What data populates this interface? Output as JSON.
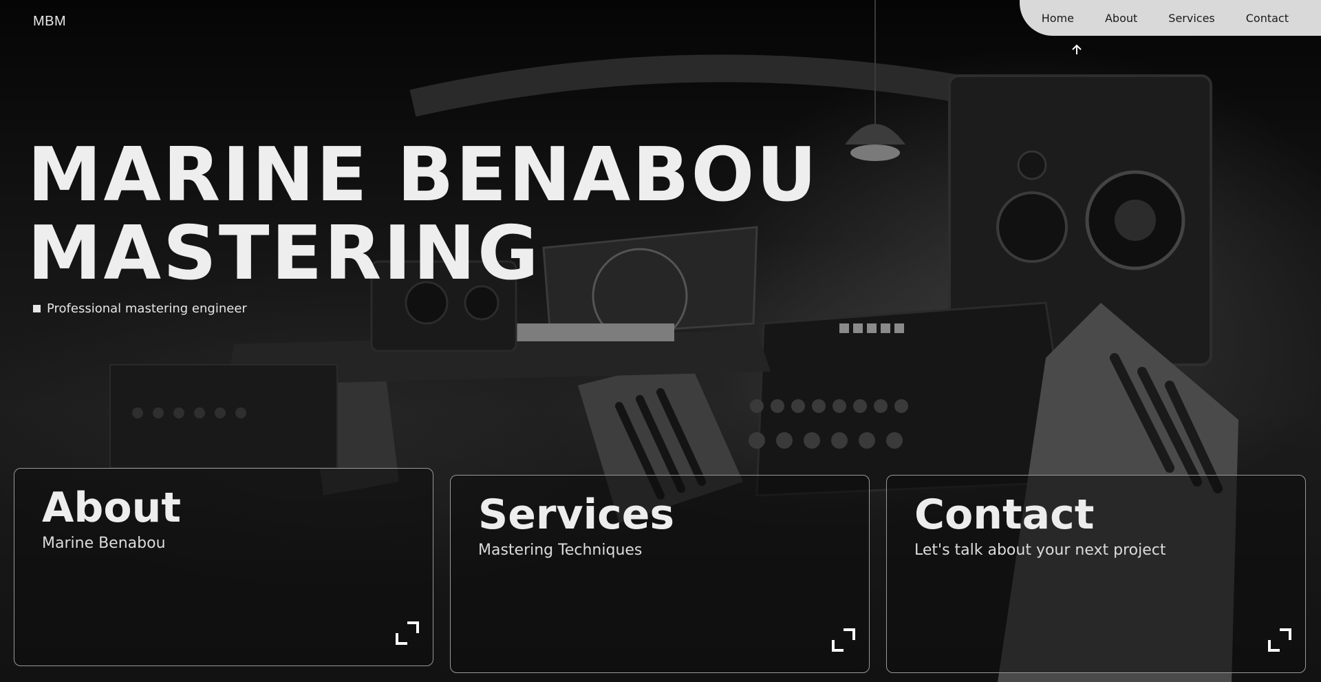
{
  "brand": {
    "logo_text": "MBM"
  },
  "nav": {
    "items": [
      {
        "label": "Home"
      },
      {
        "label": "About"
      },
      {
        "label": "Services"
      },
      {
        "label": "Contact"
      }
    ],
    "active_indicator_icon": "arrow-up-icon"
  },
  "hero": {
    "title_line_1": "MARINE BENABOU",
    "title_line_2": "MASTERING",
    "subtitle": "Professional mastering engineer"
  },
  "cards": [
    {
      "title": "About",
      "subtitle": "Marine Benabou",
      "icon": "expand-icon"
    },
    {
      "title": "Services",
      "subtitle": "Mastering Techniques",
      "icon": "expand-icon"
    },
    {
      "title": "Contact",
      "subtitle": "Let's talk about your next project",
      "icon": "expand-icon"
    }
  ],
  "colors": {
    "background": "#0b0b0b",
    "nav_background": "#d9d9d9",
    "text_primary": "#eeeeee",
    "card_border": "#9a9a9a"
  }
}
